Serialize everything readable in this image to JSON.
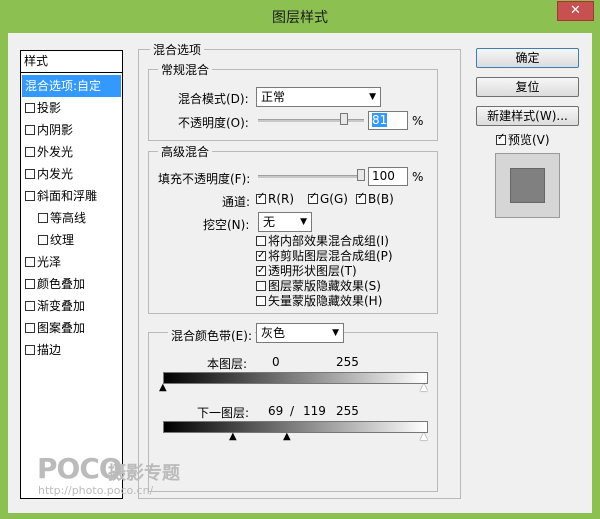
{
  "window": {
    "title": "图层样式",
    "close": "✕"
  },
  "sidebar": {
    "header": "样式",
    "items": [
      {
        "label": "混合选项:自定",
        "selected": true,
        "checkbox": false,
        "indent": false
      },
      {
        "label": "投影",
        "checkbox": true,
        "indent": false
      },
      {
        "label": "内阴影",
        "checkbox": true,
        "indent": false
      },
      {
        "label": "外发光",
        "checkbox": true,
        "indent": false
      },
      {
        "label": "内发光",
        "checkbox": true,
        "indent": false
      },
      {
        "label": "斜面和浮雕",
        "checkbox": true,
        "indent": false
      },
      {
        "label": "等高线",
        "checkbox": true,
        "indent": true
      },
      {
        "label": "纹理",
        "checkbox": true,
        "indent": true
      },
      {
        "label": "光泽",
        "checkbox": true,
        "indent": false
      },
      {
        "label": "颜色叠加",
        "checkbox": true,
        "indent": false
      },
      {
        "label": "渐变叠加",
        "checkbox": true,
        "indent": false
      },
      {
        "label": "图案叠加",
        "checkbox": true,
        "indent": false
      },
      {
        "label": "描边",
        "checkbox": true,
        "indent": false
      }
    ]
  },
  "blend": {
    "section_title": "混合选项",
    "general": {
      "title": "常规混合",
      "mode_label": "混合模式(D):",
      "mode_value": "正常",
      "opacity_label": "不透明度(O):",
      "opacity_value": "81",
      "opacity_unit": "%",
      "opacity_fraction": 0.81
    },
    "advanced": {
      "title": "高级混合",
      "fill_label": "填充不透明度(F):",
      "fill_value": "100",
      "fill_unit": "%",
      "fill_fraction": 1.0,
      "channels_label": "通道:",
      "channel_r": "R(R)",
      "channel_g": "G(G)",
      "channel_b": "B(B)",
      "knockout_label": "挖空(N):",
      "knockout_value": "无",
      "options": [
        {
          "label": "将内部效果混合成组(I)",
          "checked": false
        },
        {
          "label": "将剪贴图层混合成组(P)",
          "checked": true
        },
        {
          "label": "透明形状图层(T)",
          "checked": true
        },
        {
          "label": "图层蒙版隐藏效果(S)",
          "checked": false
        },
        {
          "label": "矢量蒙版隐藏效果(H)",
          "checked": false
        }
      ]
    },
    "blend_if": {
      "label": "混合颜色带(E):",
      "value": "灰色",
      "this_layer_label": "本图层:",
      "this_layer_low": "0",
      "this_layer_high": "255",
      "underlying_label": "下一图层:",
      "underlying_low": "69",
      "underlying_sep": "/",
      "underlying_mid": "119",
      "underlying_high": "255"
    }
  },
  "buttons": {
    "ok": "确定",
    "reset": "复位",
    "new_style": "新建样式(W)...",
    "preview_label": "预览(V)"
  },
  "watermark": {
    "brand": "POCO",
    "tagline": "摄影专题",
    "url": "http://photo.poco.cn/"
  }
}
